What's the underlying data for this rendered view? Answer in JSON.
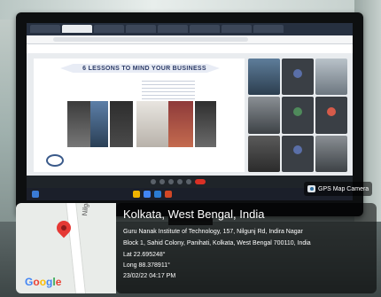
{
  "badge": {
    "label": "GPS Map Camera",
    "icon": "camera-icon"
  },
  "location": {
    "title": "Kolkata, West Bengal, India",
    "address_line1": "Guru Nanak Institute of Technology, 157, Nilgunj Rd, Indira Nagar",
    "address_line2": "Block 1, Sahid Colony, Panihati, Kolkata, West Bengal 700110, India",
    "lat": "Lat 22.695248°",
    "long": "Long 88.378911°",
    "datetime": "23/02/22 04:17 PM"
  },
  "map": {
    "road_label": "Nilgunj Rd",
    "brand": [
      "G",
      "o",
      "o",
      "g",
      "l",
      "e"
    ]
  },
  "slide": {
    "title": "6 LESSONS TO MIND YOUR BUSINESS"
  }
}
